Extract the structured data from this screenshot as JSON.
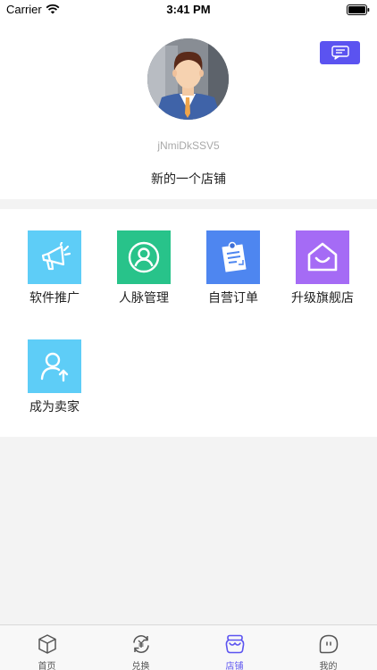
{
  "status_bar": {
    "carrier": "Carrier",
    "time": "3:41 PM"
  },
  "profile": {
    "username": "jNmiDkSSV5",
    "shop_name": "新的一个店铺",
    "message_icon": "chat-bubble-icon"
  },
  "menu": [
    {
      "label": "软件推广",
      "icon": "megaphone-icon",
      "color": "#5ecdf7"
    },
    {
      "label": "人脉管理",
      "icon": "person-circle-icon",
      "color": "#28c38a"
    },
    {
      "label": "自营订单",
      "icon": "clipboard-icon",
      "color": "#4e86f0"
    },
    {
      "label": "升级旗舰店",
      "icon": "store-house-icon",
      "color": "#a56bf5"
    },
    {
      "label": "成为卖家",
      "icon": "person-upload-icon",
      "color": "#5ecdf7"
    }
  ],
  "tabbar": [
    {
      "label": "首页",
      "icon": "cube-icon",
      "active": false
    },
    {
      "label": "兑换",
      "icon": "exchange-icon",
      "active": false
    },
    {
      "label": "店铺",
      "icon": "shop-jar-icon",
      "active": true
    },
    {
      "label": "我的",
      "icon": "face-icon",
      "active": false
    }
  ],
  "colors": {
    "accent": "#5b53f0",
    "background": "#f3f3f3"
  }
}
